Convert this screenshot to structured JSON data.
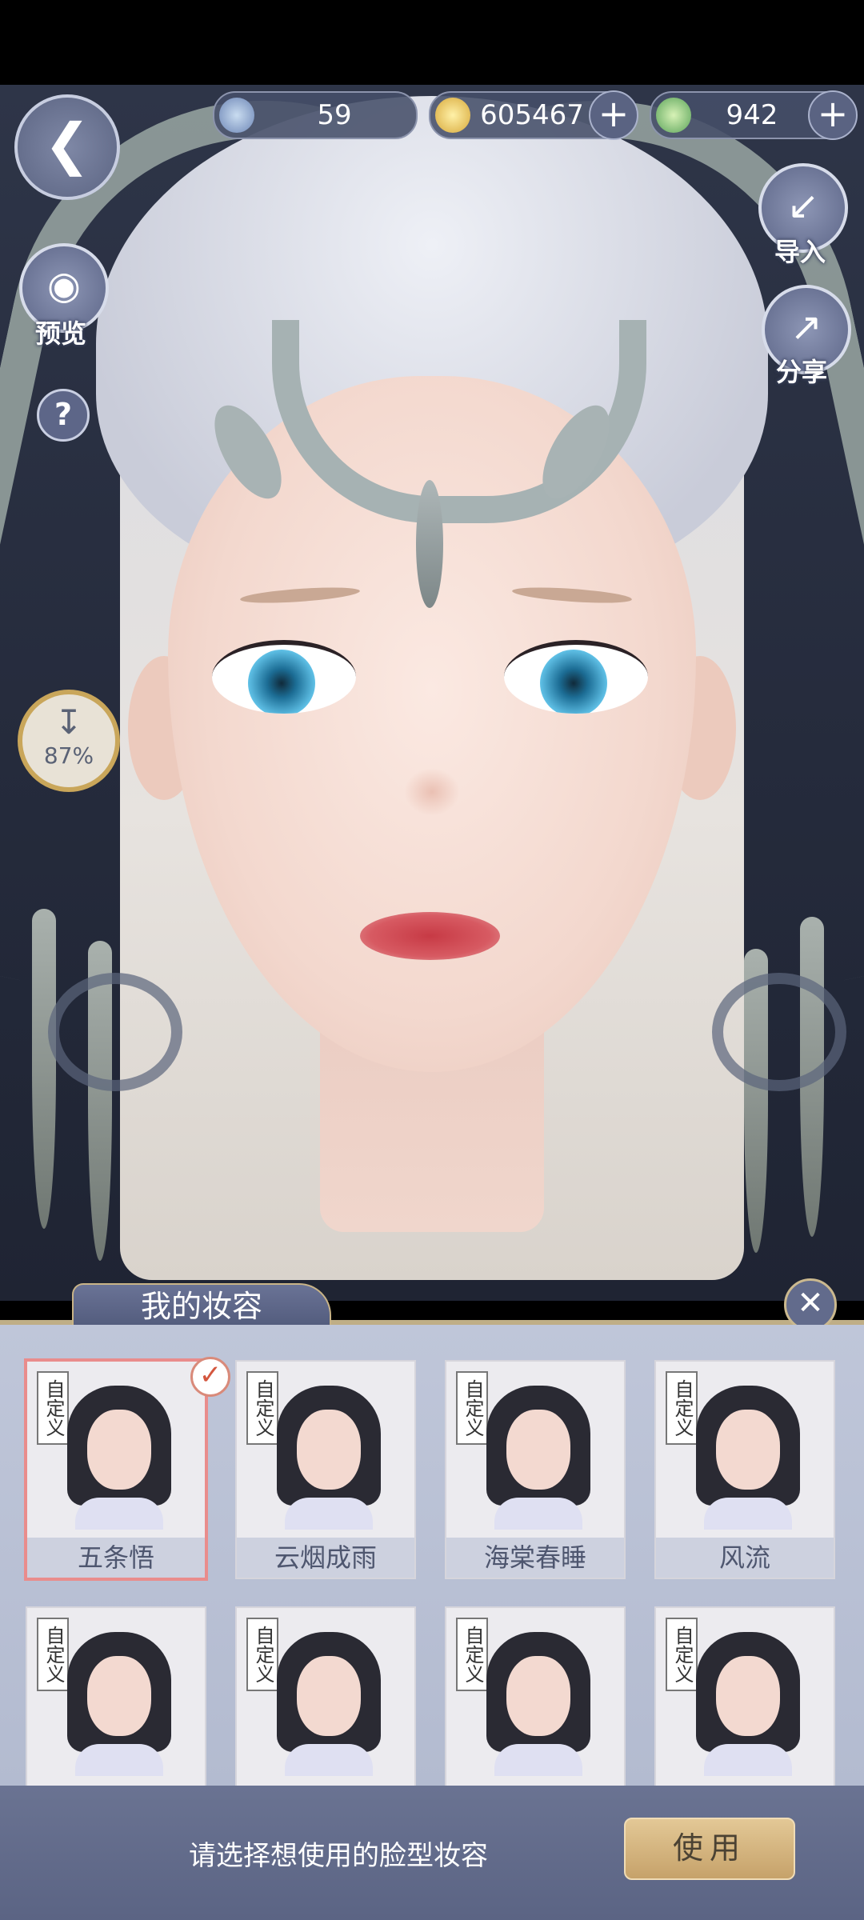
{
  "currencies": [
    {
      "icon": "jade-icon",
      "value": "59",
      "has_plus": false
    },
    {
      "icon": "coin-icon",
      "value": "605467",
      "has_plus": true
    },
    {
      "icon": "leaf-token-icon",
      "value": "942",
      "has_plus": true
    }
  ],
  "left_controls": {
    "preview_label": "预览",
    "help_label": "?",
    "download_percent": "87%"
  },
  "right_controls": {
    "import_label": "导入",
    "share_label": "分享"
  },
  "panel": {
    "title": "我的妆容",
    "items": [
      {
        "tag": "自定义",
        "name": "五条悟",
        "selected": true
      },
      {
        "tag": "自定义",
        "name": "云烟成雨",
        "selected": false
      },
      {
        "tag": "自定义",
        "name": "海棠春睡",
        "selected": false
      },
      {
        "tag": "自定义",
        "name": "风流",
        "selected": false
      },
      {
        "tag": "自定义",
        "name": "",
        "selected": false
      },
      {
        "tag": "自定义",
        "name": "",
        "selected": false
      },
      {
        "tag": "自定义",
        "name": "",
        "selected": false
      },
      {
        "tag": "自定义",
        "name": "",
        "selected": false
      }
    ]
  },
  "footer": {
    "hint": "请选择想使用的脸型妆容",
    "use_button": "使用"
  },
  "colors": {
    "panel_bg": "#bfc6d9",
    "accent_gold": "#c6a26a",
    "selected_border": "#e98c8c"
  }
}
